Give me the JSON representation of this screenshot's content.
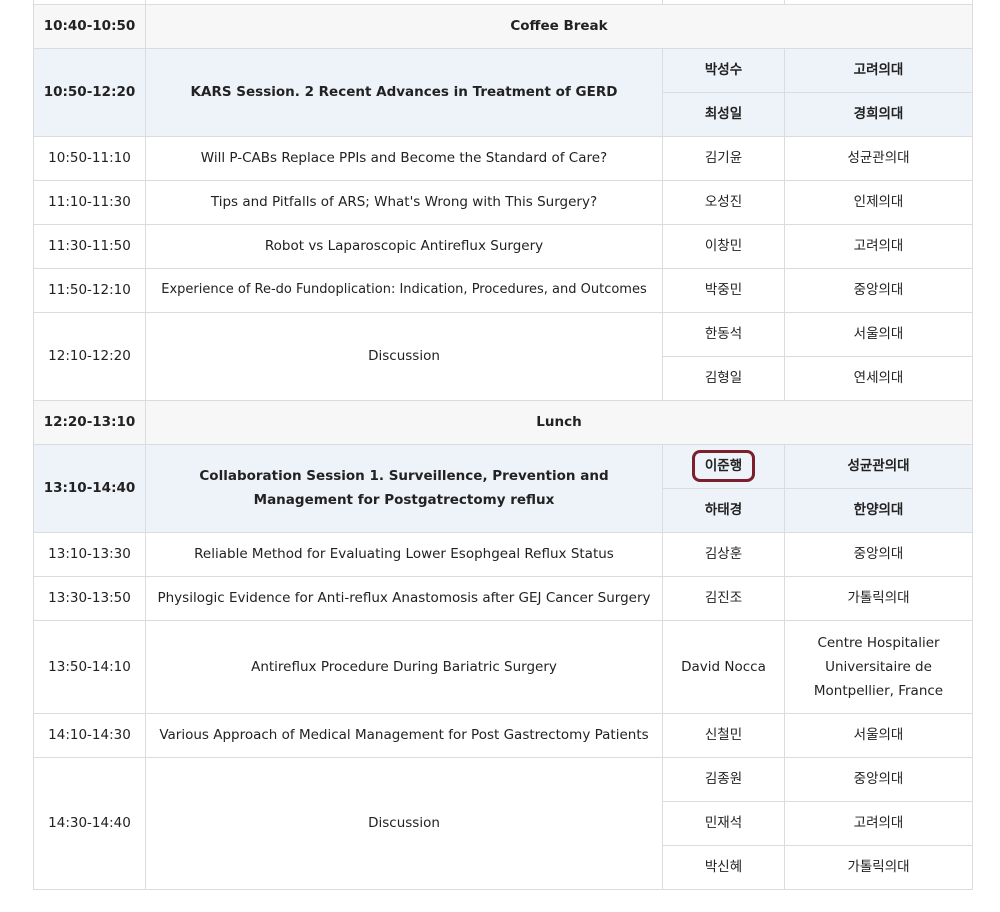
{
  "rows": {
    "coffee": {
      "time": "10:40-10:50",
      "title": "Coffee Break"
    },
    "kars": {
      "time": "10:50-12:20",
      "title": "KARS Session. 2 Recent Advances in Treatment of GERD",
      "chairs": [
        {
          "name": "박성수",
          "aff": "고려의대"
        },
        {
          "name": "최성일",
          "aff": "경희의대"
        }
      ]
    },
    "t1": {
      "time": "10:50-11:10",
      "title": "Will P-CABs Replace PPIs and Become the Standard of Care?",
      "name": "김기윤",
      "aff": "성균관의대"
    },
    "t2": {
      "time": "11:10-11:30",
      "title": "Tips and Pitfalls of ARS; What's Wrong with This Surgery?",
      "name": "오성진",
      "aff": "인제의대"
    },
    "t3": {
      "time": "11:30-11:50",
      "title": "Robot vs Laparoscopic Antireflux Surgery",
      "name": "이창민",
      "aff": "고려의대"
    },
    "t4": {
      "time": "11:50-12:10",
      "title": "Experience of Re-do Fundoplication: Indication, Procedures, and Outcomes",
      "name": "박중민",
      "aff": "중앙의대"
    },
    "d1": {
      "time": "12:10-12:20",
      "title": "Discussion",
      "panel": [
        {
          "name": "한동석",
          "aff": "서울의대"
        },
        {
          "name": "김형일",
          "aff": "연세의대"
        }
      ]
    },
    "lunch": {
      "time": "12:20-13:10",
      "title": "Lunch"
    },
    "collab": {
      "time": "13:10-14:40",
      "title": "Collaboration Session 1. Surveillence, Prevention and Management for Postgatrectomy reflux",
      "chairs": [
        {
          "name": "이준행",
          "aff": "성균관의대"
        },
        {
          "name": "하태경",
          "aff": "한양의대"
        }
      ]
    },
    "t5": {
      "time": "13:10-13:30",
      "title": "Reliable Method for Evaluating Lower Esophgeal Reflux Status",
      "name": "김상훈",
      "aff": "중앙의대"
    },
    "t6": {
      "time": "13:30-13:50",
      "title": "Physilogic Evidence for Anti-reflux Anastomosis after GEJ Cancer Surgery",
      "name": "김진조",
      "aff": "가톨릭의대"
    },
    "t7": {
      "time": "13:50-14:10",
      "title": "Antireflux Procedure During Bariatric Surgery",
      "name": "David Nocca",
      "aff": "Centre Hospitalier Universitaire de Montpellier, France"
    },
    "t8": {
      "time": "14:10-14:30",
      "title": "Various Approach of Medical Management for Post Gastrectomy Patients",
      "name": "신철민",
      "aff": "서울의대"
    },
    "d2": {
      "time": "14:30-14:40",
      "title": "Discussion",
      "panel": [
        {
          "name": "김종원",
          "aff": "중앙의대"
        },
        {
          "name": "민재석",
          "aff": "고려의대"
        },
        {
          "name": "박신혜",
          "aff": "가톨릭의대"
        }
      ]
    }
  },
  "highlight_color": "#7a1f2b"
}
